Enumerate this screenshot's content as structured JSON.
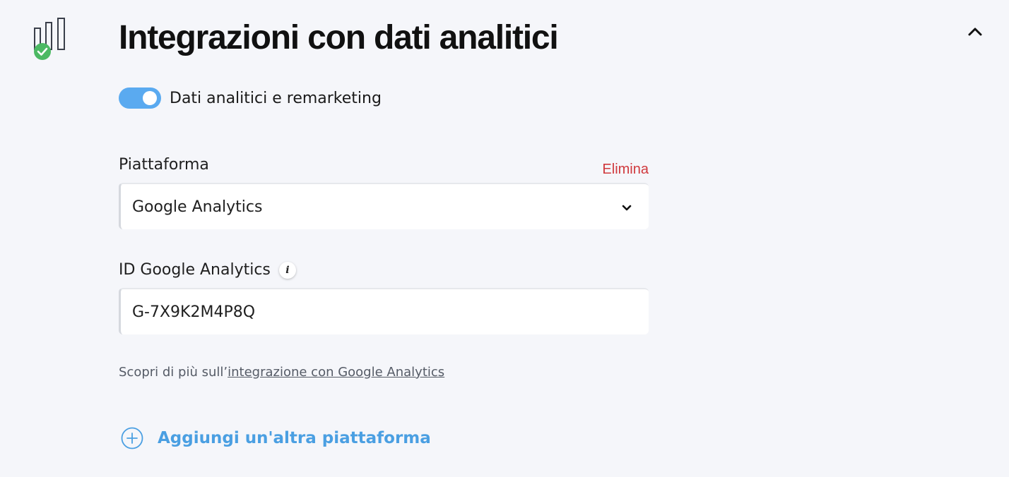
{
  "section": {
    "title": "Integrazioni con dati analitici",
    "icon": "bar-chart-check-icon",
    "collapse_icon": "chevron-up-icon"
  },
  "toggle": {
    "label": "Dati analitici e remarketing",
    "state": "on"
  },
  "platform": {
    "label": "Piattaforma",
    "delete_label": "Elimina",
    "selected": "Google Analytics"
  },
  "analytics_id": {
    "label": "ID Google Analytics",
    "value": "G-7X9K2M4P8Q",
    "info_icon": "info-icon"
  },
  "help": {
    "prefix": "Scopri di più sull’",
    "link": "integrazione con Google Analytics"
  },
  "add_platform": {
    "label": "Aggiungi un'altra piattaforma"
  },
  "colors": {
    "accent": "#4a9fe2",
    "toggle_on": "#5aaaf0",
    "danger": "#d0393d",
    "success": "#4cb963",
    "background": "#f5f6fa"
  }
}
